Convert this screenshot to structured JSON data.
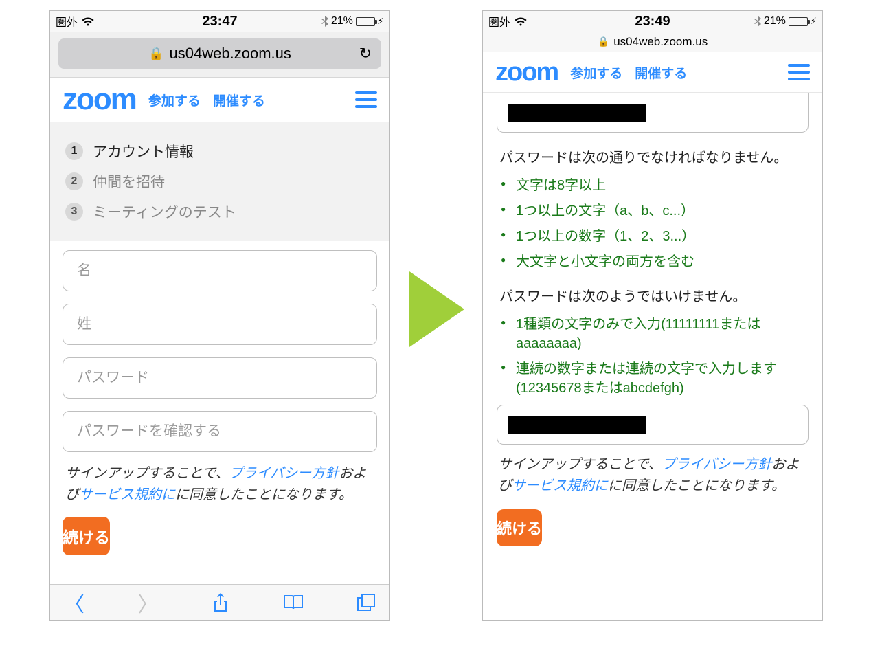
{
  "left": {
    "status": {
      "carrier": "圏外",
      "time": "23:47",
      "battery": "21%"
    },
    "url": "us04web.zoom.us",
    "header": {
      "logo": "zoom",
      "join": "参加する",
      "host": "開催する"
    },
    "steps": [
      {
        "num": "1",
        "label": "アカウント情報"
      },
      {
        "num": "2",
        "label": "仲間を招待"
      },
      {
        "num": "3",
        "label": "ミーティングのテスト"
      }
    ],
    "fields": {
      "first_name": "名",
      "last_name": "姓",
      "password": "パスワード",
      "password_confirm": "パスワードを確認する"
    },
    "disclaimer": {
      "t1": "サインアップすることで、",
      "privacy": "プライバシー方針",
      "t2": "および",
      "tos": "サービス規約に",
      "t3": "に同意したことになります。"
    },
    "continue": "続ける"
  },
  "right": {
    "status": {
      "carrier": "圏外",
      "time": "23:49",
      "battery": "21%"
    },
    "url": "us04web.zoom.us",
    "header": {
      "logo": "zoom",
      "join": "参加する",
      "host": "開催する"
    },
    "pw_must": "パスワードは次の通りでなければなりません。",
    "pw_rules": [
      "文字は8字以上",
      "1つ以上の文字（a、b、c...）",
      "1つ以上の数字（1、2、3...）",
      "大文字と小文字の両方を含む"
    ],
    "pw_must_not": "パスワードは次のようではいけません。",
    "pw_not_rules": [
      "1種類の文字のみで入力(11111111またはaaaaaaaa)",
      "連続の数字または連続の文字で入力します(12345678またはabcdefgh)"
    ],
    "disclaimer": {
      "t1": "サインアップすることで、",
      "privacy": "プライバシー方針",
      "t2": "および",
      "tos": "サービス規約に",
      "t3": "に同意したことになります。"
    },
    "continue": "続ける"
  }
}
